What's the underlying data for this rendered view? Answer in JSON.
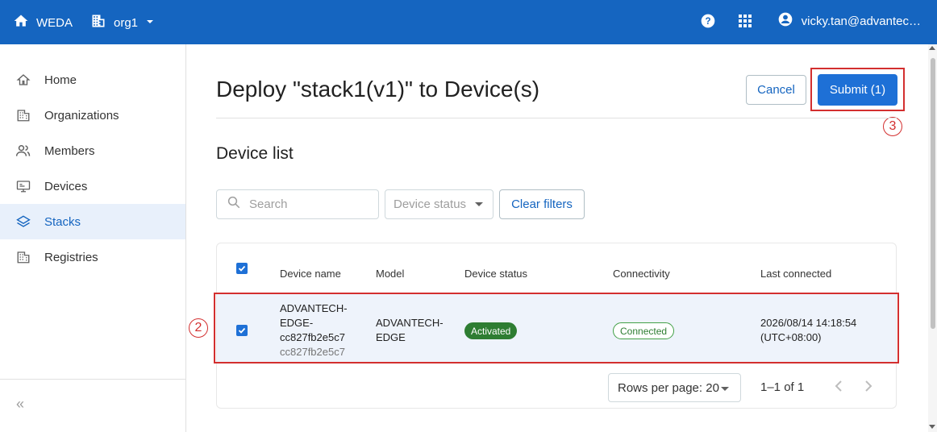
{
  "topbar": {
    "brand": "WEDA",
    "org": "org1",
    "user": "vicky.tan@advantec…",
    "icons": [
      "home-icon",
      "building-icon",
      "chevron-down-icon",
      "help-icon",
      "apps-grid-icon",
      "account-circle-icon"
    ]
  },
  "sidebar": {
    "items": [
      {
        "label": "Home",
        "icon": "home-outline-icon"
      },
      {
        "label": "Organizations",
        "icon": "building-icon"
      },
      {
        "label": "Members",
        "icon": "people-icon"
      },
      {
        "label": "Devices",
        "icon": "device-monitor-icon"
      },
      {
        "label": "Stacks",
        "icon": "layers-icon"
      },
      {
        "label": "Registries",
        "icon": "building-icon"
      }
    ],
    "collapse": "«"
  },
  "main": {
    "title": "Deploy \"stack1(v1)\" to Device(s)",
    "cancel": "Cancel",
    "submit": "Submit (1)",
    "section_title": "Device list",
    "search_placeholder": "Search",
    "status_filter": "Device status",
    "clear_filters": "Clear filters"
  },
  "table": {
    "columns": [
      "Device name",
      "Model",
      "Device status",
      "Connectivity",
      "Last connected"
    ],
    "rows": [
      {
        "name_lines": [
          "ADVANTECH-",
          "EDGE-",
          "cc827fb2e5c7"
        ],
        "name_sub": "cc827fb2e5c7",
        "model_lines": [
          "ADVANTECH-",
          "EDGE"
        ],
        "status": "Activated",
        "connectivity": "Connected",
        "last_lines": [
          "2026/08/14 14:18:54",
          "(UTC+08:00)"
        ],
        "selected": true
      }
    ]
  },
  "pagination": {
    "rows_per_page": "Rows per page: 20",
    "range": "1–1 of 1"
  },
  "annotations": {
    "step2": "2",
    "step3": "3"
  },
  "colors": {
    "topbar": "#1565c0",
    "primary": "#1e70d6",
    "highlight": "#d32f2f",
    "activated": "#2e7d32"
  }
}
